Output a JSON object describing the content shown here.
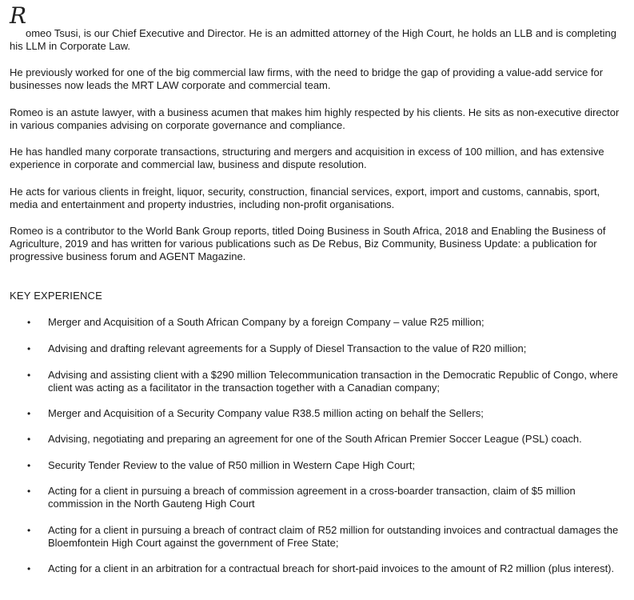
{
  "bio": {
    "dropcap": "R",
    "paragraphs": [
      "omeo Tsusi, is our Chief Executive and Director. He is an admitted attorney of the High Court, he holds an LLB and is completing his LLM in Corporate Law.",
      "He previously worked for one of the big commercial law firms, with the need to bridge the gap of providing a value-add service for businesses now leads the MRT LAW corporate and commercial team.",
      "Romeo is an astute lawyer, with a business acumen that makes him highly respected by his clients. He sits as non-executive director in various companies advising on corporate governance and compliance.",
      "He has handled many corporate transactions, structuring and mergers and acquisition in excess of 100 million, and has extensive experience in corporate and commercial law, business and dispute resolution.",
      "He acts for various clients in freight, liquor, security, construction, financial services, export, import and customs, cannabis, sport, media and entertainment and property industries, including non-profit organisations.",
      "Romeo is a contributor to the World Bank Group reports, titled Doing Business in South Africa, 2018 and Enabling the Business of Agriculture, 2019 and has written for various publications such as De Rebus, Biz Community, Business Update: a publication for progressive business forum and AGENT Magazine."
    ]
  },
  "experience": {
    "heading": "KEY EXPERIENCE",
    "bullet": "•",
    "items": [
      "Merger and Acquisition of a South African Company by a foreign Company – value R25 million;",
      "Advising and drafting relevant agreements for a Supply of Diesel Transaction to the value of R20 million;",
      "Advising and assisting client with a $290 million Telecommunication transaction in the Democratic Republic of Congo, where client was acting as a facilitator in the transaction together with a Canadian company;",
      "Merger and Acquisition of a Security Company value R38.5 million acting on behalf the Sellers;",
      "Advising, negotiating and preparing an agreement for one of the South African Premier Soccer League (PSL) coach.",
      "Security Tender Review to the value of R50 million in Western Cape High Court;",
      "Acting for a client in pursuing a breach of commission agreement in a cross-boarder transaction, claim of $5 million commission in the North Gauteng High Court",
      "Acting for a client in pursuing a breach of contract claim of R52 million for outstanding invoices and contractual damages the Bloemfontein High Court against the government of Free State;",
      "Acting for a client in an arbitration for a contractual breach for short-paid invoices to the amount of R2 million (plus interest)."
    ]
  }
}
